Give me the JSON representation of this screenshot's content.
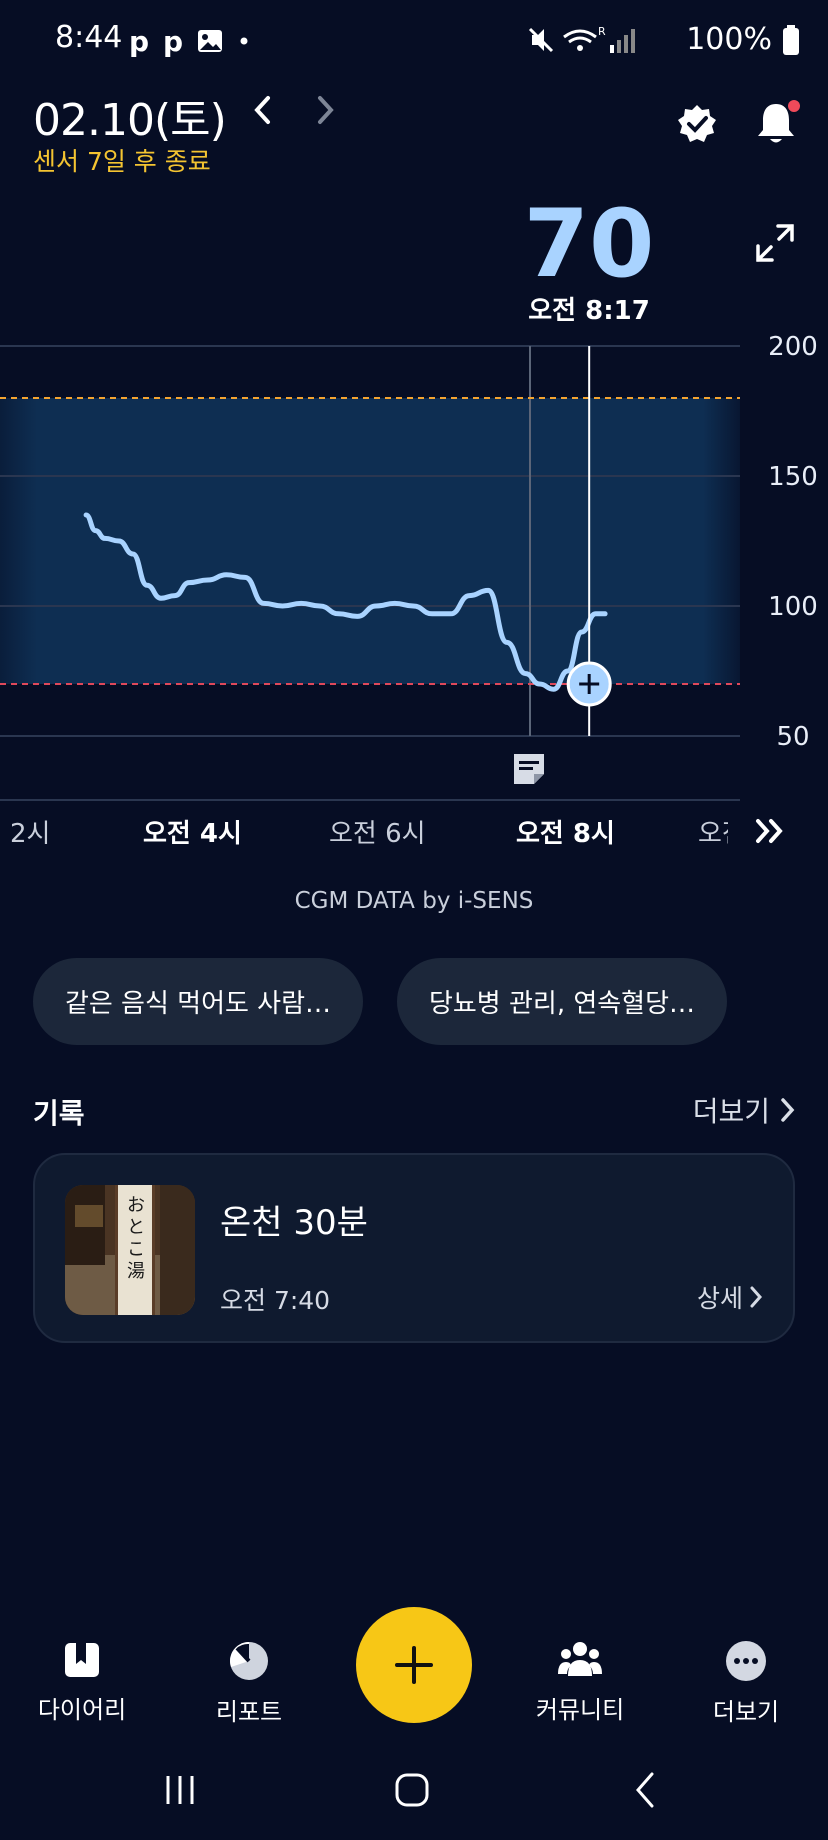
{
  "status_bar": {
    "time": "8:44",
    "battery": "100%"
  },
  "header": {
    "date": "02.10(토)",
    "sensor_note": "센서 7일 후 종료"
  },
  "current_reading": {
    "value": "70",
    "time": "오전 8:17"
  },
  "chart_data": {
    "type": "line",
    "y_ticks": [
      "200",
      "150",
      "100",
      "50"
    ],
    "ylim": [
      50,
      200
    ],
    "target_range": [
      70,
      180
    ],
    "x_ticks": [
      "2시",
      "오전 4시",
      "오전 6시",
      "오전 8시",
      "오전"
    ],
    "bold_x_ticks": [
      "오전 4시",
      "오전 8시"
    ],
    "series": [
      {
        "x": [
          2.9,
          3.0,
          3.1,
          3.25,
          3.4,
          3.55,
          3.7,
          3.85,
          4.0,
          4.2,
          4.4,
          4.6,
          4.8,
          5.0,
          5.2,
          5.4,
          5.6,
          5.8,
          6.0,
          6.2,
          6.4,
          6.6,
          6.8,
          7.0,
          7.2,
          7.4,
          7.6,
          7.75,
          7.9,
          8.05,
          8.2,
          8.35,
          8.45
        ],
        "y": [
          135,
          129,
          126,
          125,
          120,
          108,
          103,
          104,
          109,
          110,
          112,
          111,
          101,
          100,
          101,
          100,
          97,
          96,
          100,
          101,
          100,
          97,
          97,
          104,
          106,
          86,
          74,
          70,
          68,
          75,
          90,
          97,
          97
        ]
      }
    ],
    "current_marker": {
      "x": 8.28,
      "y": 70
    },
    "color": "#a9d3ff",
    "high_line_color": "#f4a431",
    "low_line_color": "#e0485a"
  },
  "footer_credit": "CGM DATA by i-SENS",
  "articles": [
    {
      "label": "같은 음식 먹어도 사람…"
    },
    {
      "label": "당뇨병 관리, 연속혈당…"
    }
  ],
  "records": {
    "title": "기록",
    "more": "더보기",
    "items": [
      {
        "title": "온천 30분",
        "time": "오전 7:40",
        "detail": "상세",
        "thumb_text": "おとこ湯"
      }
    ]
  },
  "bottom_nav": {
    "items": [
      {
        "label": "다이어리"
      },
      {
        "label": "리포트"
      },
      {
        "label": "커뮤니티"
      },
      {
        "label": "더보기"
      }
    ],
    "accent": "#f7c716"
  }
}
